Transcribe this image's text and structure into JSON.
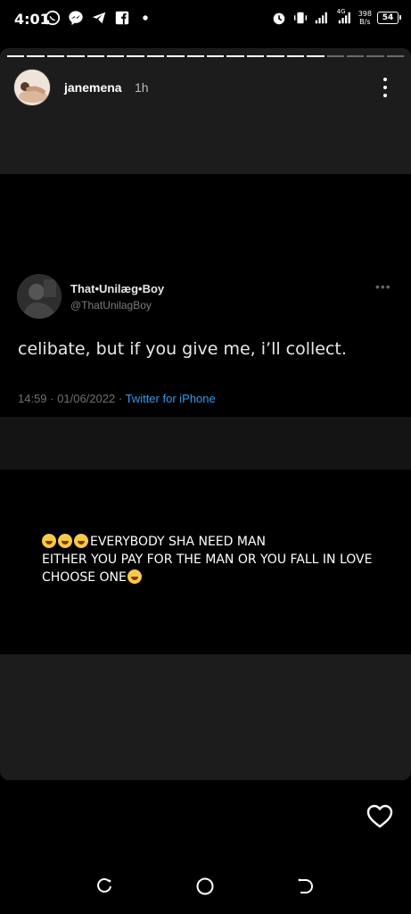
{
  "status_bar": {
    "time": "4:01",
    "network_type": "4G",
    "net_speed_value": "398",
    "net_speed_unit": "B/s",
    "battery": "54",
    "left_icons": [
      "whatsapp-icon",
      "messenger-icon",
      "telegram-icon",
      "facebook-icon",
      "dot-icon"
    ],
    "right_icons": [
      "alarm-icon",
      "vibrate-icon",
      "signal-icon",
      "signal-icon-2",
      "battery-icon"
    ]
  },
  "story": {
    "username": "janemena",
    "time_ago": "1h",
    "progress": {
      "segments": 20,
      "completed": 16
    },
    "tweet": {
      "display_name": "That•Unilæg•Boy",
      "handle": "@ThatUnilagBoy",
      "text": "celibate, but if you give me, i’ll collect.",
      "time": "14:59",
      "separator": "·",
      "date": "01/06/2022",
      "source": "Twitter for iPhone"
    },
    "caption": {
      "line1": "EVERYBODY SHA NEED MAN",
      "line2": "EITHER YOU PAY FOR THE MAN OR YOU FALL IN LOVE",
      "line3": "CHOOSE ONE"
    }
  },
  "colors": {
    "background": "#000000",
    "band": "#1c1c1c",
    "link": "#2f9bf0",
    "muted": "#7c7c7c"
  }
}
